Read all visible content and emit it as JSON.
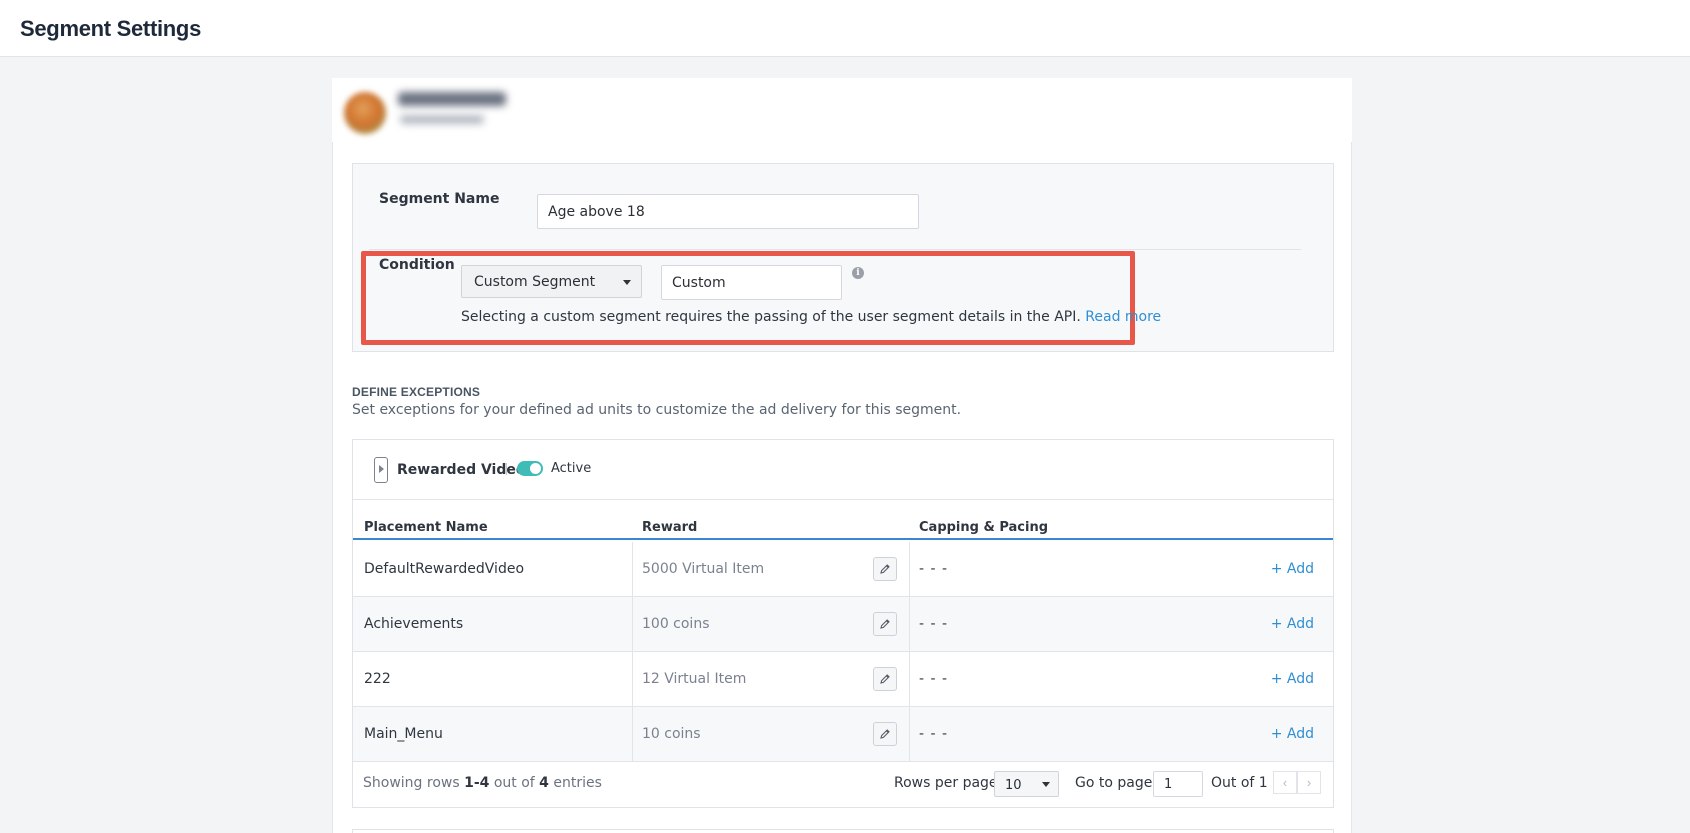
{
  "header": {
    "title": "Segment Settings"
  },
  "segment": {
    "name_label": "Segment Name",
    "name_value": "Age above 18",
    "condition_label": "Condition",
    "condition_select": "Custom Segment",
    "condition_value": "Custom",
    "info_icon": "info-icon",
    "help_text": "Selecting a custom segment requires the passing of the user segment details in the API.",
    "read_more": "Read more",
    "highlight_color": "#e8584a"
  },
  "exceptions": {
    "title": "DEFINE EXCEPTIONS",
    "description": "Set exceptions for your defined ad units to customize the ad delivery for this segment."
  },
  "ad_unit": {
    "icon": "rewarded-video-icon",
    "name": "Rewarded Video",
    "status": "Active",
    "toggle_on": true,
    "toggle_color": "#3fbcb8"
  },
  "table": {
    "columns": [
      "Placement Name",
      "Reward",
      "Capping & Pacing"
    ],
    "rows": [
      {
        "name": "DefaultRewardedVideo",
        "reward": "5000 Virtual Item",
        "capping": "- - -",
        "action": "+ Add"
      },
      {
        "name": "Achievements",
        "reward": "100 coins",
        "capping": "- - -",
        "action": "+ Add"
      },
      {
        "name": "222",
        "reward": "12 Virtual Item",
        "capping": "- - -",
        "action": "+ Add"
      },
      {
        "name": "Main_Menu",
        "reward": "10 coins",
        "capping": "- - -",
        "action": "+ Add"
      }
    ]
  },
  "footer": {
    "showing_prefix": "Showing rows",
    "range": "1-4",
    "out_of": "out of",
    "total": "4",
    "entries": "entries",
    "rows_per_page_label": "Rows per page:",
    "rows_per_page": "10",
    "go_to_page_label": "Go to page:",
    "page": "1",
    "out_of_pages": "Out of 1",
    "prev": "‹",
    "next": "›"
  },
  "colors": {
    "accent": "#2f8fd4",
    "table_header_line": "#3a86d1"
  }
}
